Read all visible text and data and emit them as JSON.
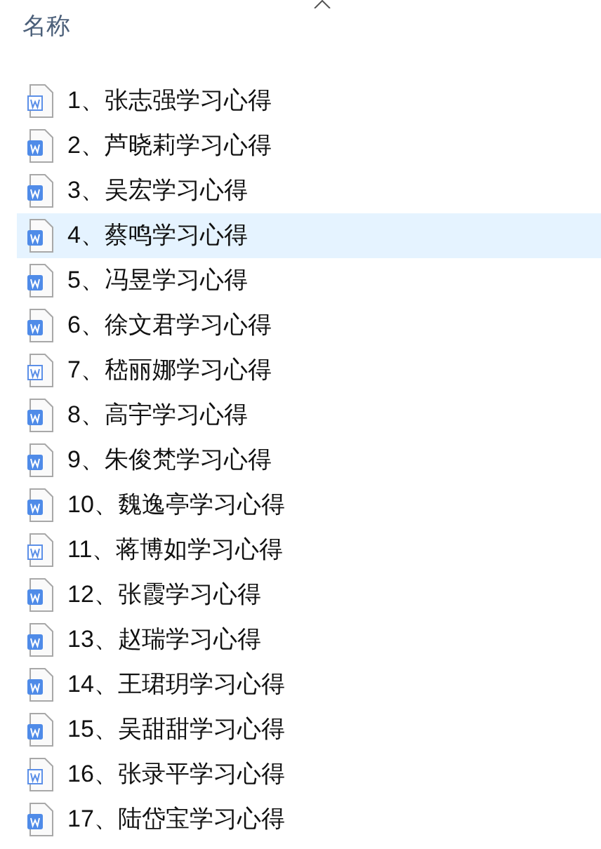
{
  "column_header": {
    "label": "名称"
  },
  "files": [
    {
      "name": "1、张志强学习心得",
      "kind": "outline",
      "selected": false
    },
    {
      "name": "2、芦晓莉学习心得",
      "kind": "solid",
      "selected": false
    },
    {
      "name": "3、吴宏学习心得",
      "kind": "solid",
      "selected": false
    },
    {
      "name": "4、蔡鸣学习心得",
      "kind": "solid",
      "selected": true
    },
    {
      "name": "5、冯昱学习心得",
      "kind": "solid",
      "selected": false
    },
    {
      "name": "6、徐文君学习心得",
      "kind": "solid",
      "selected": false
    },
    {
      "name": "7、嵇丽娜学习心得",
      "kind": "outline",
      "selected": false
    },
    {
      "name": "8、高宇学习心得",
      "kind": "solid",
      "selected": false
    },
    {
      "name": "9、朱俊梵学习心得",
      "kind": "solid",
      "selected": false
    },
    {
      "name": "10、魏逸亭学习心得",
      "kind": "solid",
      "selected": false
    },
    {
      "name": "11、蒋博如学习心得",
      "kind": "outline",
      "selected": false
    },
    {
      "name": "12、张霞学习心得",
      "kind": "solid",
      "selected": false
    },
    {
      "name": "13、赵瑞学习心得",
      "kind": "solid",
      "selected": false
    },
    {
      "name": "14、王珺玥学习心得",
      "kind": "solid",
      "selected": false
    },
    {
      "name": "15、吴甜甜学习心得",
      "kind": "solid",
      "selected": false
    },
    {
      "name": "16、张录平学习心得",
      "kind": "outline",
      "selected": false
    },
    {
      "name": "17、陆岱宝学习心得",
      "kind": "solid",
      "selected": false
    }
  ]
}
